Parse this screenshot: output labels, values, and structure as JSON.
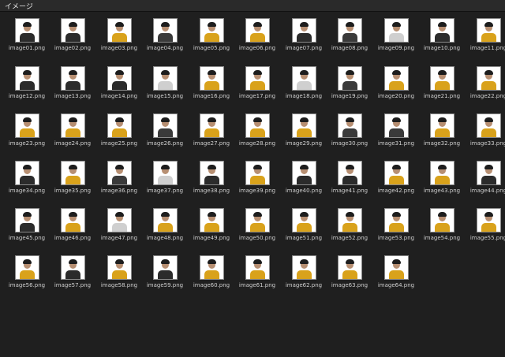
{
  "window": {
    "title": "イメージ"
  },
  "files": [
    {
      "name": "image01.png",
      "color": "#2b2b2b"
    },
    {
      "name": "image02.png",
      "color": "#2b2b2b"
    },
    {
      "name": "image03.png",
      "color": "#d9a21b"
    },
    {
      "name": "image04.png",
      "color": "#3a3a3a"
    },
    {
      "name": "image05.png",
      "color": "#d9a21b"
    },
    {
      "name": "image06.png",
      "color": "#d9a21b"
    },
    {
      "name": "image07.png",
      "color": "#2b2b2b"
    },
    {
      "name": "image08.png",
      "color": "#3a3a3a"
    },
    {
      "name": "image09.png",
      "color": "#cfcfcf"
    },
    {
      "name": "image10.png",
      "color": "#2b2b2b"
    },
    {
      "name": "image11.png",
      "color": "#d9a21b"
    },
    {
      "name": "image12.png",
      "color": "#2b2b2b"
    },
    {
      "name": "image13.png",
      "color": "#2b2b2b"
    },
    {
      "name": "image14.png",
      "color": "#2b2b2b"
    },
    {
      "name": "image15.png",
      "color": "#cfcfcf"
    },
    {
      "name": "image16.png",
      "color": "#d9a21b"
    },
    {
      "name": "image17.png",
      "color": "#d9a21b"
    },
    {
      "name": "image18.png",
      "color": "#cfcfcf"
    },
    {
      "name": "image19.png",
      "color": "#3a3a3a"
    },
    {
      "name": "image20.png",
      "color": "#d9a21b"
    },
    {
      "name": "image21.png",
      "color": "#d9a21b"
    },
    {
      "name": "image22.png",
      "color": "#d9a21b"
    },
    {
      "name": "image23.png",
      "color": "#d9a21b"
    },
    {
      "name": "image24.png",
      "color": "#d9a21b"
    },
    {
      "name": "image25.png",
      "color": "#d9a21b"
    },
    {
      "name": "image26.png",
      "color": "#3a3a3a"
    },
    {
      "name": "image27.png",
      "color": "#d9a21b"
    },
    {
      "name": "image28.png",
      "color": "#d9a21b"
    },
    {
      "name": "image29.png",
      "color": "#d9a21b"
    },
    {
      "name": "image30.png",
      "color": "#3a3a3a"
    },
    {
      "name": "image31.png",
      "color": "#3a3a3a"
    },
    {
      "name": "image32.png",
      "color": "#d9a21b"
    },
    {
      "name": "image33.png",
      "color": "#d9a21b"
    },
    {
      "name": "image34.png",
      "color": "#2b2b2b"
    },
    {
      "name": "image35.png",
      "color": "#d9a21b"
    },
    {
      "name": "image36.png",
      "color": "#3a3a3a"
    },
    {
      "name": "image37.png",
      "color": "#cfcfcf"
    },
    {
      "name": "image38.png",
      "color": "#2b2b2b"
    },
    {
      "name": "image39.png",
      "color": "#d9a21b"
    },
    {
      "name": "image40.png",
      "color": "#2b2b2b"
    },
    {
      "name": "image41.png",
      "color": "#2b2b2b"
    },
    {
      "name": "image42.png",
      "color": "#d9a21b"
    },
    {
      "name": "image43.png",
      "color": "#d9a21b"
    },
    {
      "name": "image44.png",
      "color": "#2b2b2b"
    },
    {
      "name": "image45.png",
      "color": "#2b2b2b"
    },
    {
      "name": "image46.png",
      "color": "#d9a21b"
    },
    {
      "name": "image47.png",
      "color": "#cfcfcf"
    },
    {
      "name": "image48.png",
      "color": "#d9a21b"
    },
    {
      "name": "image49.png",
      "color": "#d9a21b"
    },
    {
      "name": "image50.png",
      "color": "#d9a21b"
    },
    {
      "name": "image51.png",
      "color": "#d9a21b"
    },
    {
      "name": "image52.png",
      "color": "#d9a21b"
    },
    {
      "name": "image53.png",
      "color": "#d9a21b"
    },
    {
      "name": "image54.png",
      "color": "#d9a21b"
    },
    {
      "name": "image55.png",
      "color": "#d9a21b"
    },
    {
      "name": "image56.png",
      "color": "#d9a21b"
    },
    {
      "name": "image57.png",
      "color": "#2b2b2b"
    },
    {
      "name": "image58.png",
      "color": "#d9a21b"
    },
    {
      "name": "image59.png",
      "color": "#2b2b2b"
    },
    {
      "name": "image60.png",
      "color": "#d9a21b"
    },
    {
      "name": "image61.png",
      "color": "#d9a21b"
    },
    {
      "name": "image62.png",
      "color": "#d9a21b"
    },
    {
      "name": "image63.png",
      "color": "#d9a21b"
    },
    {
      "name": "image64.png",
      "color": "#d9a21b"
    }
  ]
}
